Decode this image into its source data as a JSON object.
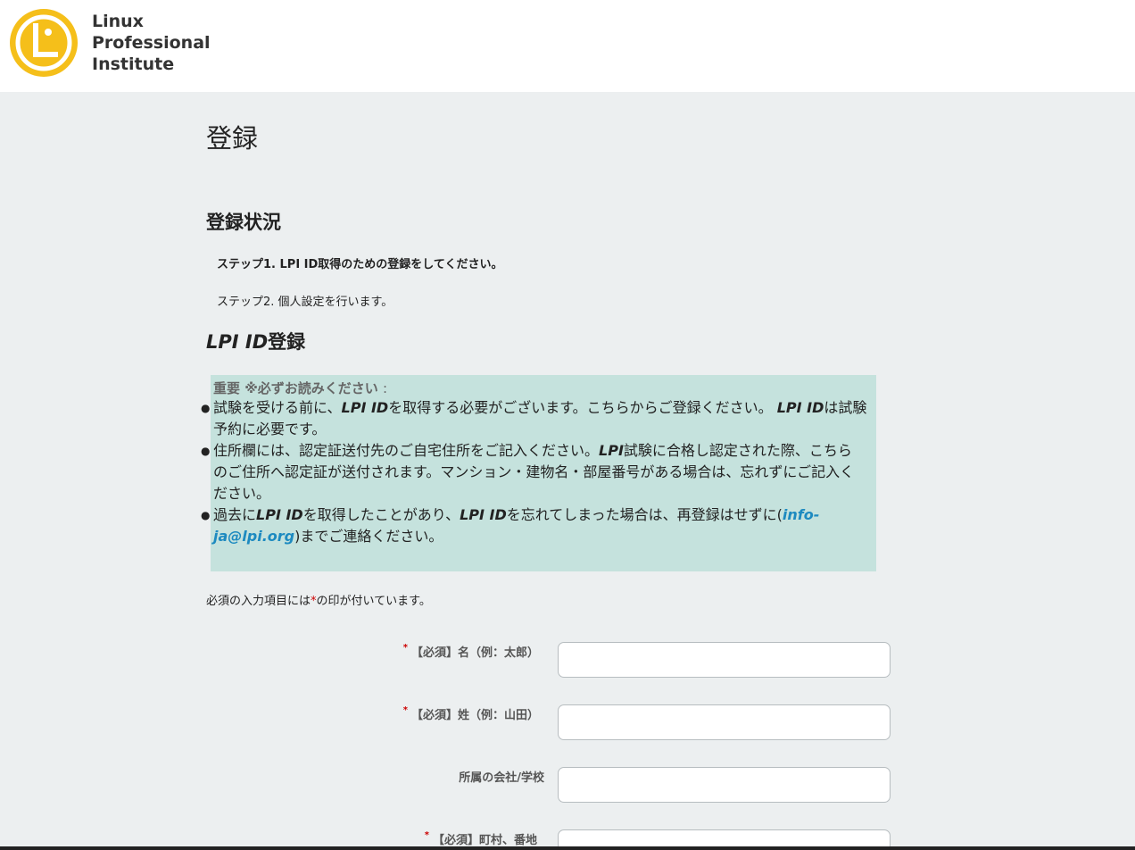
{
  "header": {
    "logo_lines": [
      "Linux",
      "Professional",
      "Institute"
    ],
    "logo_colors": {
      "ring": "#f5bf1a",
      "mark": "#ffffff"
    }
  },
  "page": {
    "title": "登録",
    "status_title": "登録状況",
    "step1": "ステップ1. LPI ID取得のための登録をしてください。",
    "step2": "ステップ2. 個人設定を行います。",
    "lpi_title_em": "LPI ID",
    "lpi_title_rest": "登録"
  },
  "notice": {
    "head_bold": "重要 ※必ずお読みください",
    "head_rest": ":",
    "items": [
      {
        "parts": [
          "試験を受ける前に、",
          "LPI ID",
          "を取得する必要がございます。こちらからご登録ください。 ",
          "LPI ID",
          "は試験予約に必要です。"
        ]
      },
      {
        "parts": [
          "住所欄には、認定証送付先のご自宅住所をご記入ください。",
          "LPI",
          "試験に合格し認定された際、こちらのご住所へ認定証が送付されます。マンション・建物名・部屋番号がある場合は、忘れずにご記入ください。"
        ]
      },
      {
        "parts": [
          "過去に",
          "LPI ID",
          "を取得したことがあり、",
          "LPI ID",
          "を忘れてしまった場合は、再登録はせずに(",
          "info-ja@lpi.org",
          ")までご連絡ください。"
        ]
      }
    ],
    "bg_color": "#c5e2dd",
    "link_color": "#1d8ac0"
  },
  "form": {
    "required_note_a": "必須の入力項目には",
    "required_note_star": "*",
    "required_note_b": "の印が付いています。",
    "fields": [
      {
        "label": "【必須】名（例：太郎）",
        "required": true
      },
      {
        "label": "【必須】姓（例：山田）",
        "required": true
      },
      {
        "label": "所属の会社/学校",
        "required": false
      },
      {
        "label": "【必須】町村、番地",
        "required": true
      }
    ]
  }
}
